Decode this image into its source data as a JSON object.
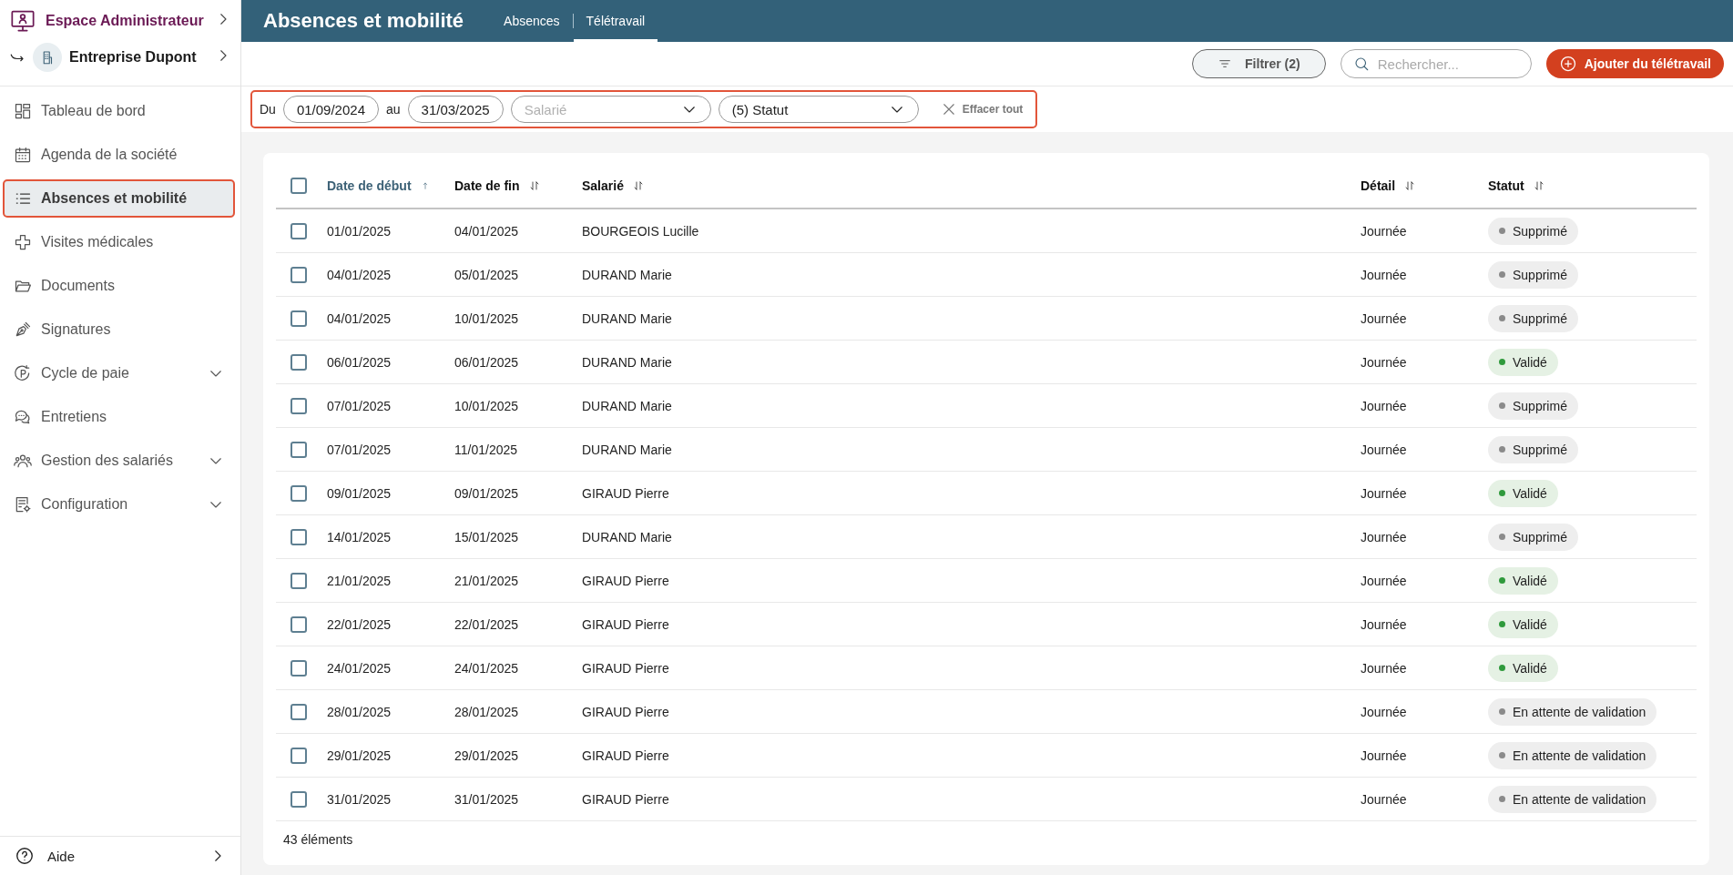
{
  "sidebar": {
    "space": {
      "label": "Espace Administrateur"
    },
    "company": {
      "label": "Entreprise Dupont"
    },
    "items": [
      {
        "label": "Tableau de bord",
        "selected": false,
        "expandable": false
      },
      {
        "label": "Agenda de la société",
        "selected": false,
        "expandable": false
      },
      {
        "label": "Absences et mobilité",
        "selected": true,
        "expandable": false
      },
      {
        "label": "Visites médicales",
        "selected": false,
        "expandable": false
      },
      {
        "label": "Documents",
        "selected": false,
        "expandable": false
      },
      {
        "label": "Signatures",
        "selected": false,
        "expandable": false
      },
      {
        "label": "Cycle de paie",
        "selected": false,
        "expandable": true
      },
      {
        "label": "Entretiens",
        "selected": false,
        "expandable": false
      },
      {
        "label": "Gestion des salariés",
        "selected": false,
        "expandable": true
      },
      {
        "label": "Configuration",
        "selected": false,
        "expandable": true
      }
    ],
    "help": {
      "label": "Aide"
    }
  },
  "header": {
    "title": "Absences et mobilité",
    "tabs": [
      {
        "label": "Absences",
        "selected": false
      },
      {
        "label": "Télétravail",
        "selected": true
      }
    ]
  },
  "toolbar": {
    "filter_button": "Filtrer (2)",
    "search": {
      "placeholder": "Rechercher..."
    },
    "add_button": "Ajouter du télétravail"
  },
  "filters": {
    "from_label": "Du",
    "from": "01/09/2024",
    "to_label": "au",
    "to": "31/03/2025",
    "employee": {
      "placeholder": "Salarié"
    },
    "status": {
      "value": "(5) Statut"
    },
    "clear": "Effacer tout"
  },
  "table": {
    "select_all": {
      "checked": false
    },
    "columns": [
      {
        "label": "Date de début",
        "sorted": true
      },
      {
        "label": "Date de fin",
        "sorted": false
      },
      {
        "label": "Salarié",
        "sorted": false
      },
      {
        "label": "Détail",
        "sorted": false
      },
      {
        "label": "Statut",
        "sorted": false
      }
    ],
    "rows": [
      {
        "checked": false,
        "start": "01/01/2025",
        "end": "04/01/2025",
        "employee": "BOURGEOIS Lucille",
        "detail": "Journée",
        "status": {
          "kind": "deleted",
          "label": "Supprimé",
          "color": "#8a8a8a"
        }
      },
      {
        "checked": false,
        "start": "04/01/2025",
        "end": "05/01/2025",
        "employee": "DURAND Marie",
        "detail": "Journée",
        "status": {
          "kind": "deleted",
          "label": "Supprimé",
          "color": "#8a8a8a"
        }
      },
      {
        "checked": false,
        "start": "04/01/2025",
        "end": "10/01/2025",
        "employee": "DURAND Marie",
        "detail": "Journée",
        "status": {
          "kind": "deleted",
          "label": "Supprimé",
          "color": "#8a8a8a"
        }
      },
      {
        "checked": false,
        "start": "06/01/2025",
        "end": "06/01/2025",
        "employee": "DURAND Marie",
        "detail": "Journée",
        "status": {
          "kind": "validated",
          "label": "Validé",
          "color": "#2f9a3c"
        }
      },
      {
        "checked": false,
        "start": "07/01/2025",
        "end": "10/01/2025",
        "employee": "DURAND Marie",
        "detail": "Journée",
        "status": {
          "kind": "deleted",
          "label": "Supprimé",
          "color": "#8a8a8a"
        }
      },
      {
        "checked": false,
        "start": "07/01/2025",
        "end": "11/01/2025",
        "employee": "DURAND Marie",
        "detail": "Journée",
        "status": {
          "kind": "deleted",
          "label": "Supprimé",
          "color": "#8a8a8a"
        }
      },
      {
        "checked": false,
        "start": "09/01/2025",
        "end": "09/01/2025",
        "employee": "GIRAUD Pierre",
        "detail": "Journée",
        "status": {
          "kind": "validated",
          "label": "Validé",
          "color": "#2f9a3c"
        }
      },
      {
        "checked": false,
        "start": "14/01/2025",
        "end": "15/01/2025",
        "employee": "DURAND Marie",
        "detail": "Journée",
        "status": {
          "kind": "deleted",
          "label": "Supprimé",
          "color": "#8a8a8a"
        }
      },
      {
        "checked": false,
        "start": "21/01/2025",
        "end": "21/01/2025",
        "employee": "GIRAUD Pierre",
        "detail": "Journée",
        "status": {
          "kind": "validated",
          "label": "Validé",
          "color": "#2f9a3c"
        }
      },
      {
        "checked": false,
        "start": "22/01/2025",
        "end": "22/01/2025",
        "employee": "GIRAUD Pierre",
        "detail": "Journée",
        "status": {
          "kind": "validated",
          "label": "Validé",
          "color": "#2f9a3c"
        }
      },
      {
        "checked": false,
        "start": "24/01/2025",
        "end": "24/01/2025",
        "employee": "GIRAUD Pierre",
        "detail": "Journée",
        "status": {
          "kind": "validated",
          "label": "Validé",
          "color": "#2f9a3c"
        }
      },
      {
        "checked": false,
        "start": "28/01/2025",
        "end": "28/01/2025",
        "employee": "GIRAUD Pierre",
        "detail": "Journée",
        "status": {
          "kind": "pending",
          "label": "En attente de validation",
          "color": "#8a8a8a"
        }
      },
      {
        "checked": false,
        "start": "29/01/2025",
        "end": "29/01/2025",
        "employee": "GIRAUD Pierre",
        "detail": "Journée",
        "status": {
          "kind": "pending",
          "label": "En attente de validation",
          "color": "#8a8a8a"
        }
      },
      {
        "checked": false,
        "start": "31/01/2025",
        "end": "31/01/2025",
        "employee": "GIRAUD Pierre",
        "detail": "Journée",
        "status": {
          "kind": "pending",
          "label": "En attente de validation",
          "color": "#8a8a8a"
        }
      }
    ],
    "footer": "43 éléments"
  }
}
